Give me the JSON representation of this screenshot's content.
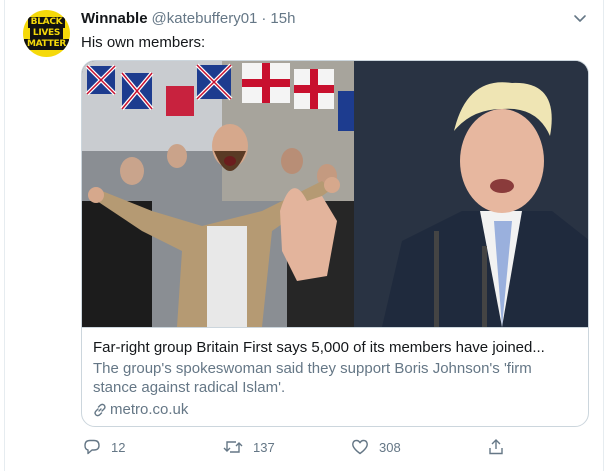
{
  "tweet": {
    "author_name": "Winnable",
    "handle": "@katebuffery01",
    "separator": "·",
    "time": "15h",
    "text": "His own members:",
    "avatar_text": [
      "BLACK",
      "LIVES",
      "MATTER"
    ]
  },
  "card": {
    "title": "Far-right group Britain First says 5,000 of its members have joined...",
    "description": "The group's spokeswoman said they support Boris Johnson's 'firm stance against radical Islam'.",
    "domain": "metro.co.uk"
  },
  "actions": {
    "reply_count": "12",
    "retweet_count": "137",
    "like_count": "308"
  },
  "colors": {
    "secondary_text": "#657786",
    "border": "#ccd6dd",
    "avatar_bg": "#f5d90a"
  },
  "icons": [
    "chevron-down-icon",
    "link-icon",
    "reply-icon",
    "retweet-icon",
    "like-icon",
    "share-icon"
  ]
}
